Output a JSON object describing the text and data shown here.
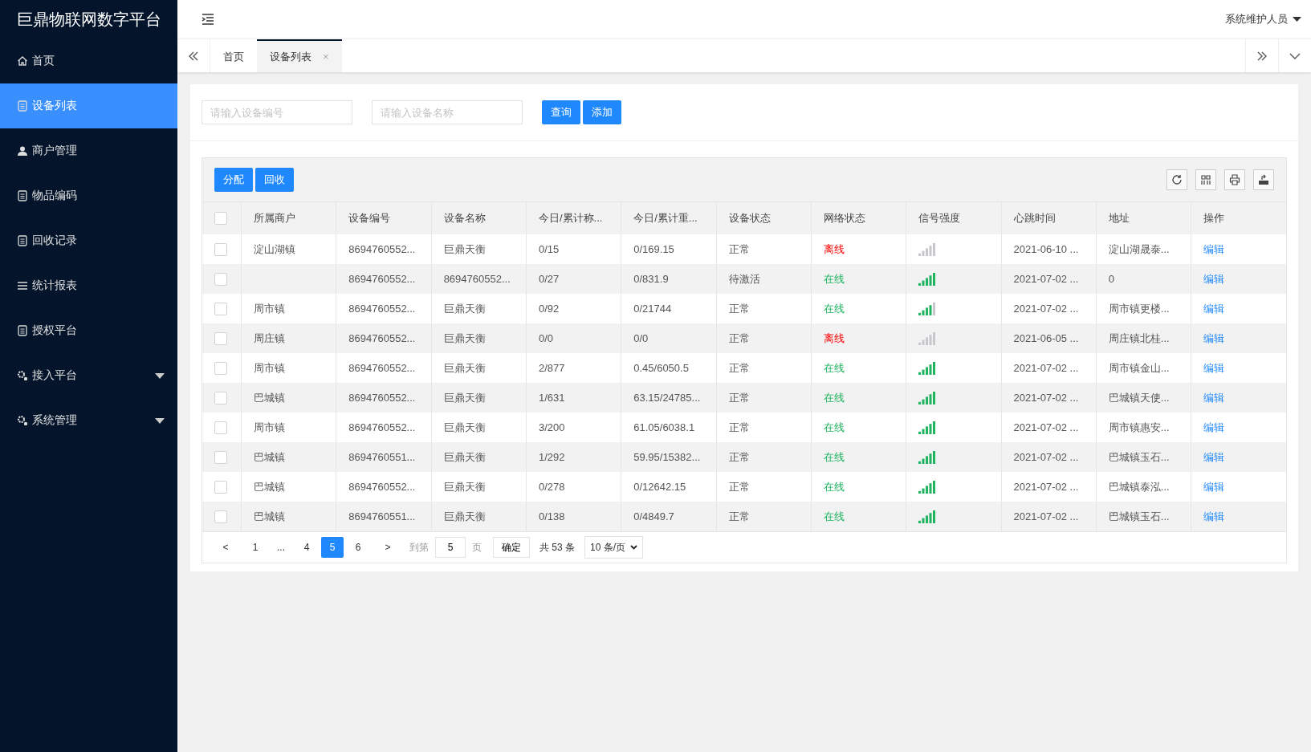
{
  "sidebar": {
    "title": "巨鼎物联网数字平台",
    "items": [
      {
        "label": "首页",
        "kind": "home",
        "selected": false,
        "expandable": false
      },
      {
        "label": "设备列表",
        "kind": "doc",
        "selected": true,
        "expandable": false
      },
      {
        "label": "商户管理",
        "kind": "user",
        "selected": false,
        "expandable": false
      },
      {
        "label": "物品编码",
        "kind": "doc",
        "selected": false,
        "expandable": false
      },
      {
        "label": "回收记录",
        "kind": "doc",
        "selected": false,
        "expandable": false
      },
      {
        "label": "统计报表",
        "kind": "list",
        "selected": false,
        "expandable": false
      },
      {
        "label": "授权平台",
        "kind": "doc",
        "selected": false,
        "expandable": false
      },
      {
        "label": "接入平台",
        "kind": "gear",
        "selected": false,
        "expandable": true
      },
      {
        "label": "系统管理",
        "kind": "gear",
        "selected": false,
        "expandable": true
      }
    ]
  },
  "header": {
    "user": "系统维护人员"
  },
  "tabs": [
    {
      "label": "首页",
      "selected": false,
      "closable": false
    },
    {
      "label": "设备列表",
      "selected": true,
      "closable": true
    }
  ],
  "tab_close": "×",
  "search": {
    "fields": [
      {
        "placeholder": "请输入设备编号"
      },
      {
        "placeholder": "请输入设备名称"
      }
    ],
    "buttons": [
      "查询",
      "添加"
    ]
  },
  "toolbar": {
    "buttons": [
      "分配",
      "回收"
    ]
  },
  "table": {
    "all_checked": false,
    "columns": [
      "所属商户",
      "设备编号",
      "设备名称",
      "今日/累计称...",
      "今日/累计重...",
      "设备状态",
      "网络状态",
      "信号强度",
      "心跳时间",
      "地址",
      "操作"
    ],
    "rows": [
      {
        "checked": false,
        "merchant": "淀山湖镇",
        "code": "8694760552...",
        "name": "巨鼎天衡",
        "count": "0/15",
        "weight": "0/169.15",
        "status": "正常",
        "network": "离线",
        "online": false,
        "signal": {
          "kind": "none"
        },
        "heartbeat": "2021-06-10 ...",
        "address": "淀山湖晟泰...",
        "action": "编辑"
      },
      {
        "checked": false,
        "merchant": "",
        "code": "8694760552...",
        "name": "8694760552...",
        "count": "0/27",
        "weight": "0/831.9",
        "status": "待激活",
        "network": "在线",
        "online": true,
        "signal": {
          "kind": "full"
        },
        "heartbeat": "2021-07-02 ...",
        "address": "0",
        "action": "编辑"
      },
      {
        "checked": false,
        "merchant": "周市镇",
        "code": "8694760552...",
        "name": "巨鼎天衡",
        "count": "0/92",
        "weight": "0/21744",
        "status": "正常",
        "network": "在线",
        "online": true,
        "signal": {
          "kind": "good"
        },
        "heartbeat": "2021-07-02 ...",
        "address": "周市镇更楼...",
        "action": "编辑"
      },
      {
        "checked": false,
        "merchant": "周庄镇",
        "code": "8694760552...",
        "name": "巨鼎天衡",
        "count": "0/0",
        "weight": "0/0",
        "status": "正常",
        "network": "离线",
        "online": false,
        "signal": {
          "kind": "none"
        },
        "heartbeat": "2021-06-05 ...",
        "address": "周庄镇北桂...",
        "action": "编辑"
      },
      {
        "checked": false,
        "merchant": "周市镇",
        "code": "8694760552...",
        "name": "巨鼎天衡",
        "count": "2/877",
        "weight": "0.45/6050.5",
        "status": "正常",
        "network": "在线",
        "online": true,
        "signal": {
          "kind": "full"
        },
        "heartbeat": "2021-07-02 ...",
        "address": "周市镇金山...",
        "action": "编辑"
      },
      {
        "checked": false,
        "merchant": "巴城镇",
        "code": "8694760552...",
        "name": "巨鼎天衡",
        "count": "1/631",
        "weight": "63.15/24785...",
        "status": "正常",
        "network": "在线",
        "online": true,
        "signal": {
          "kind": "full"
        },
        "heartbeat": "2021-07-02 ...",
        "address": "巴城镇天使...",
        "action": "编辑"
      },
      {
        "checked": false,
        "merchant": "周市镇",
        "code": "8694760552...",
        "name": "巨鼎天衡",
        "count": "3/200",
        "weight": "61.05/6038.1",
        "status": "正常",
        "network": "在线",
        "online": true,
        "signal": {
          "kind": "full"
        },
        "heartbeat": "2021-07-02 ...",
        "address": "周市镇惠安...",
        "action": "编辑"
      },
      {
        "checked": false,
        "merchant": "巴城镇",
        "code": "8694760551...",
        "name": "巨鼎天衡",
        "count": "1/292",
        "weight": "59.95/15382...",
        "status": "正常",
        "network": "在线",
        "online": true,
        "signal": {
          "kind": "full"
        },
        "heartbeat": "2021-07-02 ...",
        "address": "巴城镇玉石...",
        "action": "编辑"
      },
      {
        "checked": false,
        "merchant": "巴城镇",
        "code": "8694760552...",
        "name": "巨鼎天衡",
        "count": "0/278",
        "weight": "0/12642.15",
        "status": "正常",
        "network": "在线",
        "online": true,
        "signal": {
          "kind": "full"
        },
        "heartbeat": "2021-07-02 ...",
        "address": "巴城镇泰泓...",
        "action": "编辑"
      },
      {
        "checked": false,
        "merchant": "巴城镇",
        "code": "8694760551...",
        "name": "巨鼎天衡",
        "count": "0/138",
        "weight": "0/4849.7",
        "status": "正常",
        "network": "在线",
        "online": true,
        "signal": {
          "kind": "full"
        },
        "heartbeat": "2021-07-02 ...",
        "address": "巴城镇玉石...",
        "action": "编辑"
      }
    ]
  },
  "pagination": {
    "prev": "<",
    "next": ">",
    "pages": [
      {
        "label": "1",
        "selected": false
      },
      {
        "label": "...",
        "selected": false
      },
      {
        "label": "4",
        "selected": false
      },
      {
        "label": "5",
        "selected": true
      },
      {
        "label": "6",
        "selected": false
      }
    ],
    "goto_label": "到第",
    "goto_value": "5",
    "page_unit": "页",
    "confirm": "确定",
    "total": "共 53 条",
    "page_size": "10 条/页"
  }
}
